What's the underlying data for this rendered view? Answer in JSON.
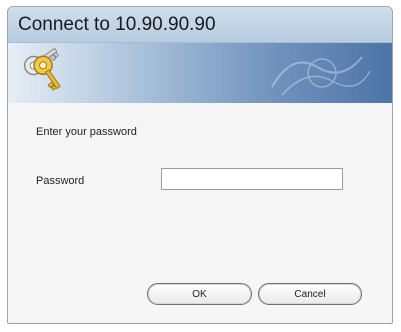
{
  "dialog": {
    "title": "Connect to 10.90.90.90",
    "prompt": "Enter your password",
    "password_label": "Password",
    "password_value": "",
    "ok_label": "OK",
    "cancel_label": "Cancel"
  },
  "icons": {
    "banner": "keys-icon"
  },
  "colors": {
    "titlebar": "#c3d6ea",
    "banner_dark": "#4d74a8",
    "dialog_bg": "#f6f6f6"
  }
}
